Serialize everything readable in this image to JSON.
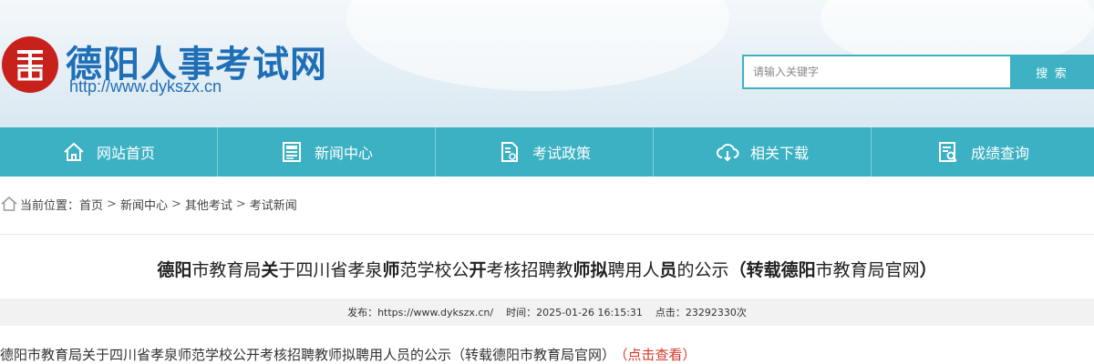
{
  "header": {
    "site_title": "德阳人事考试网",
    "site_url": "http://www.dykszx.cn",
    "search_placeholder": "请输入关键字",
    "search_button": "搜 索"
  },
  "nav": {
    "items": [
      {
        "label": "网站首页",
        "icon": "home-icon"
      },
      {
        "label": "新闻中心",
        "icon": "news-icon"
      },
      {
        "label": "考试政策",
        "icon": "policy-document-icon"
      },
      {
        "label": "相关下载",
        "icon": "cloud-download-icon"
      },
      {
        "label": "成绩查询",
        "icon": "score-search-icon"
      }
    ]
  },
  "breadcrumb": {
    "prefix": "当前位置：",
    "items": [
      "首页",
      "新闻中心",
      "其他考试",
      "考试新闻"
    ]
  },
  "article": {
    "title_parts": [
      {
        "text": "德阳",
        "bold": true
      },
      {
        "text": "市教育局",
        "bold": false
      },
      {
        "text": "关",
        "bold": true
      },
      {
        "text": "于四川省孝泉",
        "bold": false
      },
      {
        "text": "师",
        "bold": true
      },
      {
        "text": "范学校公",
        "bold": false
      },
      {
        "text": "开",
        "bold": true
      },
      {
        "text": "考核招聘教",
        "bold": false
      },
      {
        "text": "师拟",
        "bold": true
      },
      {
        "text": "聘用人",
        "bold": false
      },
      {
        "text": "员",
        "bold": true
      },
      {
        "text": "的公示",
        "bold": false
      },
      {
        "text": "（转载德阳",
        "bold": true
      },
      {
        "text": "市教育局官网",
        "bold": false
      },
      {
        "text": "）",
        "bold": true
      }
    ],
    "meta": {
      "publisher": "发布：https://www.dykszx.cn/",
      "time": "时间：2025-01-26 16:15:31",
      "clicks": "点击：23292330次"
    },
    "body_text": "德阳市教育局关于四川省孝泉师范学校公开考核招聘教师拟聘用人员的公示（转载德阳市教育局官网）",
    "body_link": "（点击查看）"
  },
  "colors": {
    "nav_bg": "#3cb1c3",
    "title_blue": "#1f6fb7",
    "seal_red": "#c8211c",
    "link_red": "#d23a2a"
  }
}
